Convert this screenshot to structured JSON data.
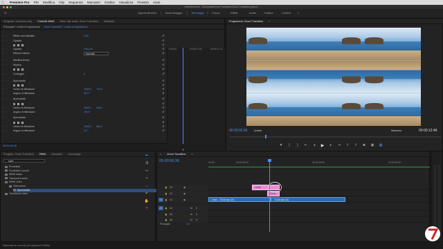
{
  "menubar": {
    "apple": "",
    "app": "Premiere Pro",
    "items": [
      "File",
      "Modifica",
      "Clip",
      "Sequenza",
      "Marcatori",
      "Grafica",
      "Visualizza",
      "Finestra",
      "Aiuto"
    ]
  },
  "titlebar": {
    "path": "/Utenti/ronnie/.../Scrivania/Zoom Transition/Zoom Transition.prproj *"
  },
  "workspaces": {
    "tabs": [
      "Apprendimento",
      "Assemblaggio",
      "Montaggio",
      "Colore",
      "Effetti",
      "Audio",
      "Grafica",
      "Librerie"
    ],
    "active": "Montaggio",
    "more": "»"
  },
  "effect_controls": {
    "tabs": [
      "Sorgente: (nessuna clip)",
      "Controlli effetti",
      "Mixer clip audio: Zoom Transition",
      "Metadati"
    ],
    "active_tab": "Controlli effetti",
    "source": "Principale * Livello di regolazione",
    "seq": "Zoom Transition * Livello di regolazione",
    "ruler": [
      "6:06:33",
      "00:00:07:00",
      "00:00:07:12"
    ],
    "timecode": "00:00:06:36",
    "rows": [
      {
        "label": "Effetto anti-sfarfallio",
        "value": "0,00"
      },
      {
        "label": "Opacità",
        "value": ""
      },
      {
        "label": "",
        "shapes": true
      },
      {
        "label": "Opacità",
        "value": "100,0 %"
      },
      {
        "label": "Metodo fusione",
        "dropdown": "Normale"
      },
      {
        "label": "Modifica tempo",
        "value": ""
      },
      {
        "label": "Replica",
        "value": ""
      },
      {
        "label": "",
        "shapes": true
      },
      {
        "label": "Conteggio",
        "value": "3"
      },
      {
        "label": "Specularità",
        "value": ""
      },
      {
        "label": "",
        "shapes": true
      },
      {
        "label": "Centro di riflessione",
        "value": "1440,0",
        "value2": "720,0"
      },
      {
        "label": "Angolo di riflessione",
        "value": "90,0 °"
      },
      {
        "label": "Specularità",
        "value": ""
      },
      {
        "label": "",
        "shapes": true
      },
      {
        "label": "Centro di riflessione",
        "value": "1440,0",
        "value2": "540,0"
      },
      {
        "label": "Angolo di riflessione",
        "value": "-90,0 °"
      },
      {
        "label": "Specularità",
        "value": ""
      },
      {
        "label": "",
        "shapes": true
      },
      {
        "label": "Centro di riflessione",
        "value": "1440,0",
        "value2": "540,0"
      },
      {
        "label": "Angolo di riflessione",
        "value": "0,0 °"
      }
    ]
  },
  "program_monitor": {
    "title": "Programma: Zoom Transition",
    "menu_icon": "≡",
    "timecode": "00:00:06:36",
    "fit": "Adatta",
    "quality": "Massima",
    "duration": "00:00:12:48",
    "controls": [
      "marker-icon",
      "in-icon",
      "out-icon",
      "go-in-icon",
      "step-back-icon",
      "play-icon",
      "step-forward-icon",
      "go-out-icon",
      "lift-icon",
      "extract-icon",
      "export-frame-icon",
      "compare-icon",
      "settings-icon"
    ]
  },
  "project": {
    "tabs": [
      "Progetto: Zoom Transition",
      "Effetti",
      "Marcatori",
      "Cronologia"
    ],
    "active_tab": "Effetti",
    "search": "spec",
    "items": [
      {
        "label": "Predefiniti",
        "indent": 0
      },
      {
        "label": "Predefiniti Lumetri",
        "indent": 0
      },
      {
        "label": "Effetti audio",
        "indent": 0
      },
      {
        "label": "Transizioni audio",
        "indent": 0
      },
      {
        "label": "Effetti video",
        "indent": 0
      },
      {
        "label": "Distorsione",
        "indent": 1
      },
      {
        "label": "Specularità",
        "indent": 2,
        "selected": true
      },
      {
        "label": "Transizioni video",
        "indent": 0
      }
    ]
  },
  "status": {
    "text": "Rilasciate su una clip per applicare l'effetto."
  },
  "tools": [
    "selection-tool",
    "track-select-tool",
    "ripple-edit-tool",
    "razor-tool",
    "slip-tool",
    "pen-tool",
    "hand-tool",
    "type-tool"
  ],
  "timeline": {
    "title": "Zoom Transition",
    "menu_icon": "≡",
    "timecode": "00:00:06:36",
    "ruler": [
      "00:00",
      "00:00:05:00",
      "00:00:10:00",
      "00:00:15:00"
    ],
    "tracks": [
      {
        "id": "V3",
        "target": "",
        "type": "video"
      },
      {
        "id": "V2",
        "target": "",
        "type": "video"
      },
      {
        "id": "V1",
        "target": "V1",
        "type": "video"
      },
      {
        "id": "A1",
        "target": "A1",
        "type": "audio"
      },
      {
        "id": "A2",
        "target": "",
        "type": "audio"
      },
      {
        "id": "A3",
        "target": "",
        "type": "audio"
      }
    ],
    "master_label": "Principale",
    "master_value": "0,0",
    "clips": {
      "v3_adjust": "Livello",
      "v2_adjust": "Livello",
      "v1_a": "Zoom - 72108.mp4 [V]",
      "v1_b": "72108.mp4 [V]"
    }
  },
  "colors": {
    "accent": "#4f8ee8",
    "adjustment_clip": "#e98ed6",
    "video_clip": "#2d6ab0",
    "green_bar": "#2e9e3e"
  },
  "logo": {
    "text": "7"
  }
}
